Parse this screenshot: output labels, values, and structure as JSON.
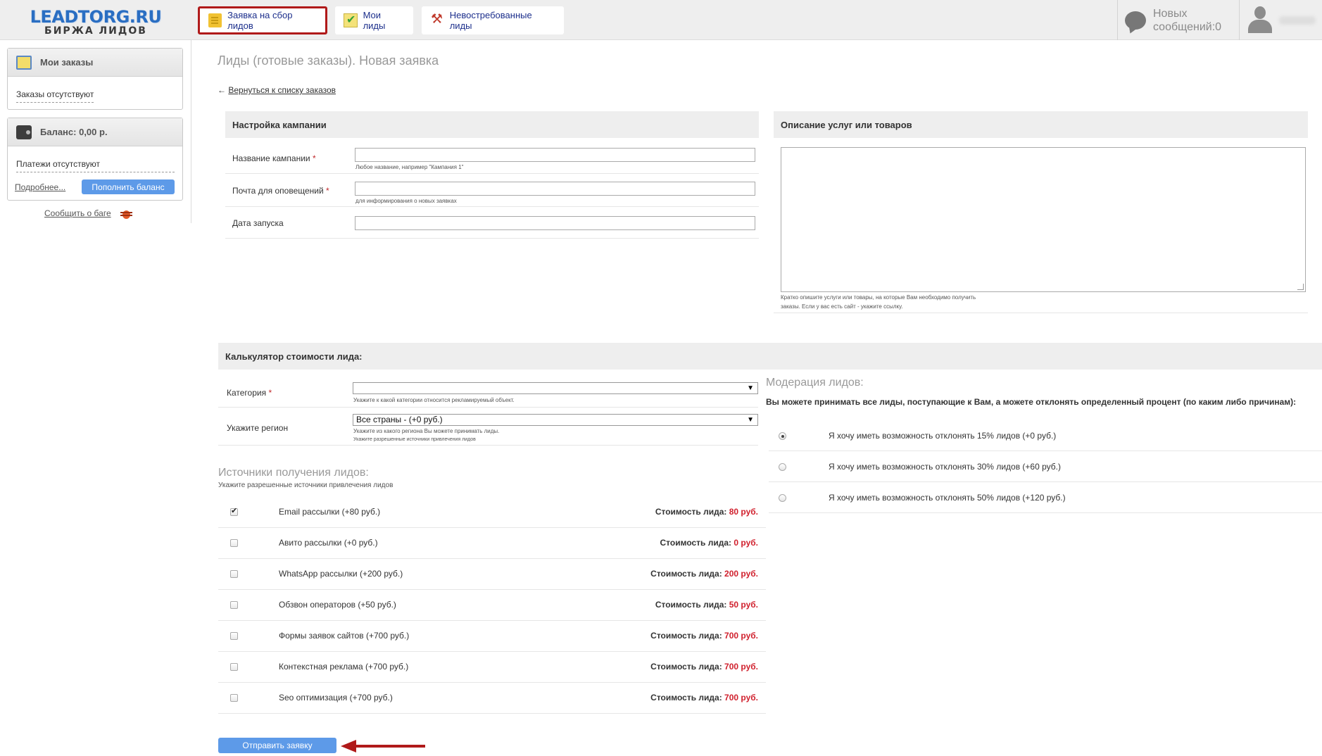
{
  "logo": {
    "line1": "LEADTORG.RU",
    "line2": "БИРЖА ЛИДОВ"
  },
  "nav": {
    "tabs": [
      {
        "label": "Заявка на сбор лидов",
        "icon": "document-icon",
        "active": true
      },
      {
        "label": "Мои лиды",
        "icon": "checklist-icon"
      },
      {
        "label": "Невостребованные лиды",
        "icon": "hammer-icon"
      }
    ],
    "messages": {
      "line1": "Новых",
      "line2": "сообщений:0"
    }
  },
  "sidebar": {
    "orders": {
      "title": "Мои заказы",
      "empty": "Заказы отсутствуют"
    },
    "balance": {
      "title": "Баланс: 0,00 р.",
      "empty": "Платежи отсутствуют",
      "more": "Подробнее...",
      "topup": "Пополнить баланс"
    },
    "report_bug": "Сообщить о баге"
  },
  "page": {
    "title": "Лиды (готовые заказы). Новая заявка",
    "back_arrow": "←",
    "back_link": "Вернуться к списку заказов"
  },
  "campaign": {
    "header": "Настройка кампании",
    "name_label": "Название кампании",
    "name_hint": "Любое название, например \"Кампания 1\"",
    "email_label": "Почта для оповещений",
    "email_hint": "для информирования о новых заявках",
    "date_label": "Дата запуска",
    "required_mark": "*"
  },
  "description": {
    "header": "Описание услуг или товаров",
    "hint_line1": "Кратко опишите услуги или товары, на которые Вам необходимо получить",
    "hint_line2": "заказы. Если у вас есть сайт - укажите ссылку."
  },
  "calculator": {
    "header": "Калькулятор стоимости лида:",
    "category_label": "Категория",
    "category_value": "",
    "category_hint": "Укажите к какой категории относится рекламируемый объект.",
    "region_label": "Укажите регион",
    "region_value": "Все страны - (+0 руб.)",
    "region_hint1": "Укажите из какого региона Вы можете принимать лиды.",
    "region_hint2": "Укажите разрешенные источники привлечения лидов",
    "select_arrow": "▼"
  },
  "sources": {
    "title": "Источники получения лидов:",
    "subtitle": "Укажите разрешенные источники привлечения лидов",
    "price_prefix": "Стоимость лида:",
    "items": [
      {
        "label": "Email рассылки (+80 руб.)",
        "price": "80 руб.",
        "checked": true
      },
      {
        "label": "Авито рассылки (+0 руб.)",
        "price": "0 руб.",
        "checked": false
      },
      {
        "label": "WhatsApp рассылки (+200 руб.)",
        "price": "200 руб.",
        "checked": false
      },
      {
        "label": "Обзвон операторов (+50 руб.)",
        "price": "50 руб.",
        "checked": false
      },
      {
        "label": "Формы заявок сайтов (+700 руб.)",
        "price": "700 руб.",
        "checked": false
      },
      {
        "label": "Контекстная реклама (+700 руб.)",
        "price": "700 руб.",
        "checked": false
      },
      {
        "label": "Seo оптимизация (+700 руб.)",
        "price": "700 руб.",
        "checked": false
      }
    ]
  },
  "moderation": {
    "title": "Модерация лидов:",
    "desc": "Вы можете принимать все лиды, поступающие к Вам, а можете отклонять определенный процент (по каким либо причинам):",
    "options": [
      {
        "label": "Я хочу иметь возможность отклонять 15% лидов (+0 руб.)",
        "selected": true
      },
      {
        "label": "Я хочу иметь возможность отклонять 30% лидов (+60 руб.)",
        "selected": false
      },
      {
        "label": "Я хочу иметь возможность отклонять 50% лидов (+120 руб.)",
        "selected": false
      }
    ]
  },
  "submit_label": "Отправить заявку",
  "colors": {
    "accent_blue": "#5d9ae8",
    "price_red": "#d01f2c",
    "active_tab_border": "#b01a1a",
    "arrow_red": "#b01a1a"
  }
}
